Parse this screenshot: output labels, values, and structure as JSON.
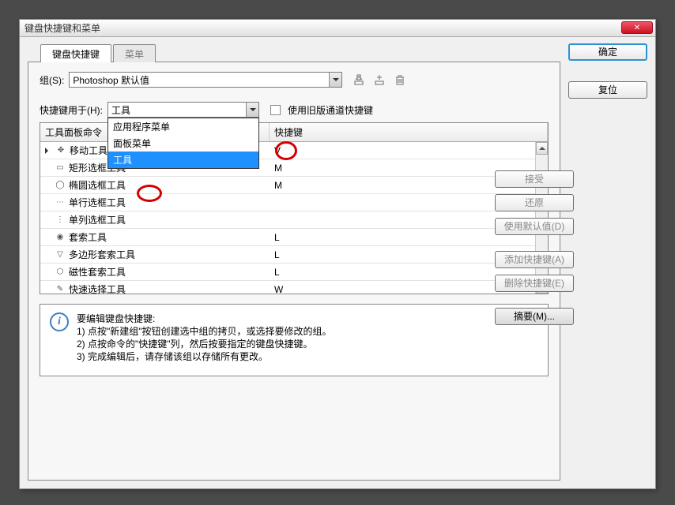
{
  "title": "键盘快捷键和菜单",
  "tabs": {
    "t0": "键盘快捷键",
    "t1": "菜单"
  },
  "set": {
    "label": "组(S):",
    "value": "Photoshop 默认值"
  },
  "for": {
    "label": "快捷键用于(H):",
    "value": "工具"
  },
  "legacy": "使用旧版通道快捷键",
  "dd": {
    "i0": "应用程序菜单",
    "i1": "面板菜单",
    "i2": "工具"
  },
  "th": {
    "c1": "工具面板命令",
    "c2": "快捷键"
  },
  "rows": [
    {
      "name": "移动工具",
      "key": "V"
    },
    {
      "name": "矩形选框工具",
      "key": "M"
    },
    {
      "name": "椭圆选框工具",
      "key": "M"
    },
    {
      "name": "单行选框工具",
      "key": ""
    },
    {
      "name": "单列选框工具",
      "key": ""
    },
    {
      "name": "套索工具",
      "key": "L"
    },
    {
      "name": "多边形套索工具",
      "key": "L"
    },
    {
      "name": "磁性套索工具",
      "key": "L"
    },
    {
      "name": "快速选择工具",
      "key": "W"
    }
  ],
  "info": {
    "title": "要编辑键盘快捷键:",
    "l1": "1) 点按\"新建组\"按钮创建选中组的拷贝，或选择要修改的组。",
    "l2": "2) 点按命令的\"快捷键\"列，然后按要指定的键盘快捷键。",
    "l3": "3) 完成编辑后，请存储该组以存储所有更改。"
  },
  "btns": {
    "ok": "确定",
    "reset": "复位",
    "accept": "接受",
    "undo": "还原",
    "default": "使用默认值(D)",
    "add": "添加快捷键(A)",
    "del": "删除快捷键(E)",
    "summary": "摘要(M)..."
  }
}
